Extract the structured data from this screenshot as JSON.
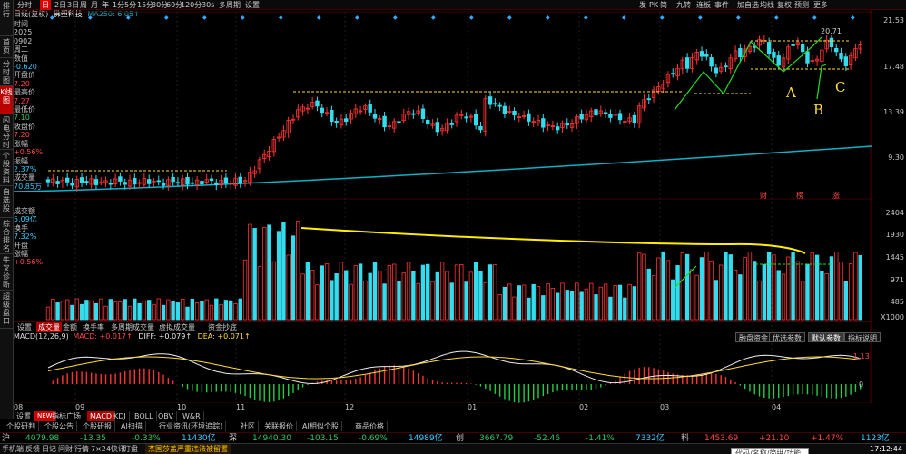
{
  "left_nav": [
    "排行",
    "首页",
    "分时图",
    "K线图",
    "闪电分时",
    "个股资料",
    "自选股",
    "综合排名",
    "牛叉诊断",
    "超级盘口"
  ],
  "left_nav_active": 3,
  "top_bar": {
    "periods": [
      "分时",
      "日",
      "2日",
      "3日",
      "周",
      "月",
      "年",
      "1分",
      "5分",
      "15分",
      "30分",
      "60分",
      "120分",
      "30s",
      "多周期",
      "设置"
    ],
    "active_period": 1,
    "right_tools": [
      "发",
      "PK",
      "简",
      "九转",
      "连板",
      "事件",
      "加自选",
      "均线",
      "复权",
      "预测",
      "更多"
    ]
  },
  "stock": {
    "title": "日线(复权)",
    "name": "佛塑科技",
    "ma_label": "MA250: 6.05↑"
  },
  "info_panel": [
    {
      "label": "时间",
      "value": "2025",
      "cls": "lbl"
    },
    {
      "label": "",
      "value": "0902",
      "cls": "lbl"
    },
    {
      "label": "",
      "value": "周二",
      "cls": "lbl"
    },
    {
      "label": "数值",
      "value": "-0.620",
      "cls": "val-c"
    },
    {
      "label": "开盘价",
      "value": "7.20",
      "cls": "val"
    },
    {
      "label": "最高价",
      "value": "7.27",
      "cls": "val"
    },
    {
      "label": "最低价",
      "value": "7.10",
      "cls": "val-g"
    },
    {
      "label": "收盘价",
      "value": "7.20",
      "cls": "val"
    },
    {
      "label": "涨幅",
      "value": "+0.56%",
      "cls": "val"
    },
    {
      "label": "振幅",
      "value": "2.37%",
      "cls": "val-c"
    },
    {
      "label": "成交量",
      "value": "70.85万",
      "cls": "val-c"
    }
  ],
  "vol_info": [
    {
      "label": "成交额",
      "value": "5.09亿",
      "cls": "val-c"
    },
    {
      "label": "换手",
      "value": "7.32%",
      "cls": "val-c"
    },
    {
      "label": "开盘",
      "value": "",
      "cls": "lbl"
    },
    {
      "label": "涨幅",
      "value": "+0.56%",
      "cls": "val"
    }
  ],
  "vol_unit": "万↑",
  "price_axis": [
    "21.53",
    "17.48",
    "13.39",
    "9.30"
  ],
  "volume_axis": [
    "2404",
    "1930",
    "1445",
    "971",
    "485",
    "X1000"
  ],
  "macd_axis": [
    "1.13",
    "0"
  ],
  "high_label": "20.71",
  "annotations": {
    "a": "A",
    "b": "B",
    "c": "C"
  },
  "event_markers": [
    "财",
    "榜",
    "涨"
  ],
  "indicator_tabs": [
    "设置",
    "成交量",
    "金额",
    "换手率",
    "多周期成交量",
    "虚拟成交量",
    "资金抄底"
  ],
  "indicator_tabs_active": 1,
  "macd_legend": {
    "title": "MACD(12,26,9)",
    "macd": "MACD: +0.017↑",
    "diff": "DIFF: +0.079↑",
    "dea": "DEA: +0.071↑"
  },
  "macd_right_tabs": [
    "融盘资金",
    "优选参数",
    "默认参数",
    "指标说明"
  ],
  "macd_right_active": 2,
  "date_axis": [
    "08",
    "09",
    "10",
    "11",
    "12",
    "01",
    "02",
    "03",
    "04"
  ],
  "bottom_tabs": [
    "设置",
    "NEW",
    "指标广场",
    "MACD",
    "KDJ",
    "BOLL",
    "OBV",
    "W&R"
  ],
  "bottom_tabs_active": 3,
  "sub_tabs": [
    "个股研判",
    "个股公告",
    "个股研报",
    "AI扫描",
    "行业资讯(环境追踪)",
    "社区",
    "关联报价",
    "AI相似个股",
    "商品价格"
  ],
  "ticker": [
    {
      "name": "沪",
      "price": "4079.98",
      "chg": "-13.35",
      "pct": "-0.33%",
      "amt": "11430亿"
    },
    {
      "name": "深",
      "price": "14940.30",
      "chg": "-103.15",
      "pct": "-0.69%",
      "amt": "14989亿"
    },
    {
      "name": "创",
      "price": "3667.79",
      "chg": "-52.46",
      "pct": "-1.41%",
      "amt": "7332亿"
    },
    {
      "name": "科",
      "price": "1453.69",
      "chg": "+21.10",
      "pct": "+1.47%",
      "amt": "1123亿"
    }
  ],
  "status": {
    "items": [
      "手机端",
      "反馈",
      "日记",
      "问财",
      "行情",
      "7×24快讯",
      "盯盘"
    ],
    "news": "杰国莎盖严重违法被留置",
    "search_placeholder": "代码/名称/简拼/功能",
    "time": "17:12:44"
  },
  "colors": {
    "up": "#ff3333",
    "down": "#33ddee",
    "ma": "#10b0c8",
    "annotation": "#ffdd33",
    "arrow": "#22dd22"
  },
  "chart_data": {
    "type": "candlestick+volume+macd",
    "price_axis_ticks": [
      21.53,
      17.48,
      13.39,
      9.3
    ],
    "ma250_last": 6.05,
    "swing_high": 20.71,
    "volume_axis_ticks_x1000": [
      2404,
      1930,
      1445,
      971,
      485
    ],
    "months": [
      "08",
      "09",
      "10",
      "11",
      "12",
      "01",
      "02",
      "03",
      "04"
    ]
  }
}
